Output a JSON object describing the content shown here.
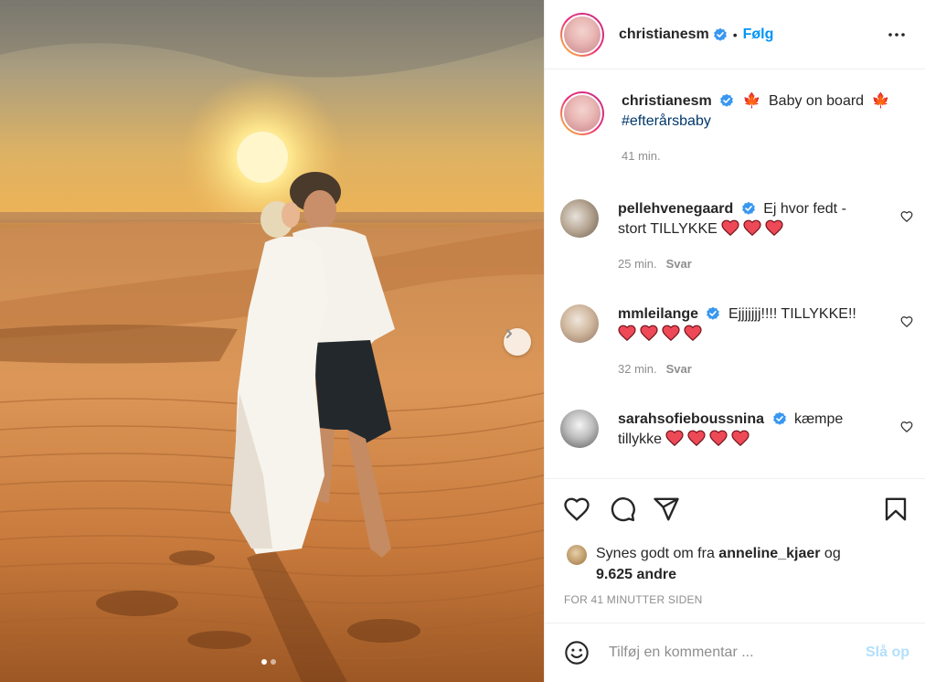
{
  "post": {
    "author": "christianesm",
    "follow_label": "Følg",
    "separator": "•",
    "more_icon": "more-horizontal-icon",
    "image_dots": 2,
    "active_dot": 0
  },
  "caption": {
    "author": "christianesm",
    "leaf_emoji": "🍁",
    "text": "Baby on board",
    "hashtag": "#efterårsbaby",
    "time": "41 min."
  },
  "comments": [
    {
      "author": "pellehvenegaard",
      "text_line1": "Ej hvor fedt -",
      "text_line2": "stort TILLYKKE",
      "hearts": 3,
      "time": "25 min.",
      "reply": "Svar"
    },
    {
      "author": "mmleilange",
      "text_line1": "Ejjjjjjj!!!! TILLYKKE!!",
      "text_line2": "",
      "hearts": 4,
      "time": "32 min.",
      "reply": "Svar"
    },
    {
      "author": "sarahsofieboussnina",
      "text_line1": "kæmpe",
      "text_line2": "tillykke",
      "hearts": 4,
      "time": "",
      "reply": ""
    }
  ],
  "likes": {
    "prefix": "Synes godt om fra",
    "user": "anneline_kjaer",
    "conjunction": "og",
    "others": "9.625 andre"
  },
  "timestamp": "FOR 41 MINUTTER SIDEN",
  "add_comment": {
    "placeholder": "Tilføj en kommentar ...",
    "post_label": "Slå op"
  },
  "colors": {
    "accent": "#0095f6",
    "verified": "#3897f0",
    "heart": "#ed4956",
    "muted": "#8e8e8e",
    "post_disabled": "#b2dffc"
  }
}
